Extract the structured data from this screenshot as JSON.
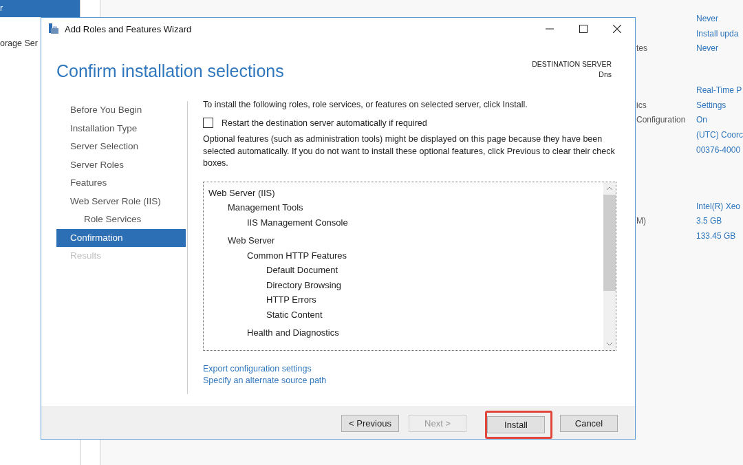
{
  "background": {
    "sidebar_items": [
      {
        "label": "r",
        "selected": true
      },
      {
        "label": "orage Ser",
        "selected": false
      }
    ],
    "properties": [
      {
        "value": "Never"
      },
      {
        "value": "Install upda"
      },
      {
        "label": "tes",
        "value": "Never"
      },
      {
        "value": "Real-Time P"
      },
      {
        "label": "ics",
        "value": "Settings"
      },
      {
        "label": "Configuration",
        "value": "On"
      },
      {
        "value": "(UTC) Coorc"
      },
      {
        "value": "00376-4000"
      },
      {
        "value": "Intel(R) Xeo"
      },
      {
        "label": "M)",
        "value": "3.5 GB"
      },
      {
        "value": "133.45 GB"
      }
    ]
  },
  "window": {
    "title": "Add Roles and Features Wizard"
  },
  "header": {
    "title": "Confirm installation selections",
    "destination_label": "DESTINATION SERVER",
    "destination_server": "Dns"
  },
  "steps": [
    {
      "label": "Before You Begin",
      "selected": false,
      "disabled": false
    },
    {
      "label": "Installation Type",
      "selected": false,
      "disabled": false
    },
    {
      "label": "Server Selection",
      "selected": false,
      "disabled": false
    },
    {
      "label": "Server Roles",
      "selected": false,
      "disabled": false
    },
    {
      "label": "Features",
      "selected": false,
      "disabled": false
    },
    {
      "label": "Web Server Role (IIS)",
      "selected": false,
      "disabled": false,
      "children": [
        {
          "label": "Role Services",
          "selected": false,
          "disabled": false
        }
      ]
    },
    {
      "label": "Confirmation",
      "selected": true,
      "disabled": false
    },
    {
      "label": "Results",
      "selected": false,
      "disabled": true
    }
  ],
  "instruction": "To install the following roles, role services, or features on selected server, click Install.",
  "restart_checkbox": {
    "label": "Restart the destination server automatically if required",
    "checked": false
  },
  "note": "Optional features (such as administration tools) might be displayed on this page because they have been selected automatically. If you do not want to install these optional features, click Previous to clear their check boxes.",
  "features": [
    {
      "label": "Web Server (IIS)",
      "children": [
        {
          "label": "Management Tools",
          "children": [
            {
              "label": "IIS Management Console"
            }
          ]
        },
        {
          "label": "Web Server",
          "children": [
            {
              "label": "Common HTTP Features",
              "children": [
                {
                  "label": "Default Document"
                },
                {
                  "label": "Directory Browsing"
                },
                {
                  "label": "HTTP Errors"
                },
                {
                  "label": "Static Content"
                }
              ]
            },
            {
              "label": "Health and Diagnostics"
            }
          ]
        }
      ]
    }
  ],
  "links": [
    "Export configuration settings",
    "Specify an alternate source path"
  ],
  "buttons": [
    {
      "label": "< Previous",
      "disabled": false,
      "highlighted": false
    },
    {
      "label": "Next >",
      "disabled": true,
      "highlighted": false
    },
    {
      "label": "Install",
      "disabled": false,
      "highlighted": true
    },
    {
      "label": "Cancel",
      "disabled": false,
      "highlighted": false
    }
  ]
}
